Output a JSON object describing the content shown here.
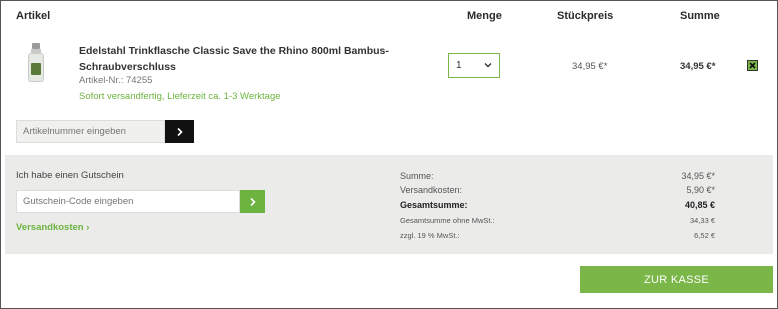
{
  "table": {
    "headers": {
      "artikel": "Artikel",
      "menge": "Menge",
      "stueckpreis": "Stückpreis",
      "summe": "Summe"
    }
  },
  "item": {
    "title": "Edelstahl Trinkflasche Classic Save the Rhino 800ml Bambus-Schraubverschluss",
    "article_number": "Artikel-Nr.: 74255",
    "shipping_info": "Sofort versandfertig, Lieferzeit ca. 1-3 Werktage",
    "quantity": "1",
    "unit_price": "34,95 €*",
    "line_total": "34,95 €*",
    "image_icon": "bottle-image"
  },
  "article_entry": {
    "placeholder": "Artikelnummer eingeben"
  },
  "voucher": {
    "label": "Ich habe einen Gutschein",
    "placeholder": "Gutschein-Code eingeben",
    "shipping_costs_link": "Versandkosten ›"
  },
  "summary": {
    "rows": [
      {
        "label": "Summe:",
        "value": "34,95 €*"
      },
      {
        "label": "Versandkosten:",
        "value": "5,90 €*"
      },
      {
        "label": "Gesamtsumme:",
        "value": "40,85 €"
      },
      {
        "label": "Gesamtsumme ohne MwSt.:",
        "value": "34,33 €"
      },
      {
        "label": "zzgl. 19 % MwSt.:",
        "value": "6,52 €"
      }
    ]
  },
  "checkout": {
    "label": "ZUR KASSE"
  },
  "colors": {
    "accent_green": "#7ab648",
    "link_green": "#6cb33f",
    "panel_bg": "#ebebea",
    "dark_button": "#111111"
  }
}
